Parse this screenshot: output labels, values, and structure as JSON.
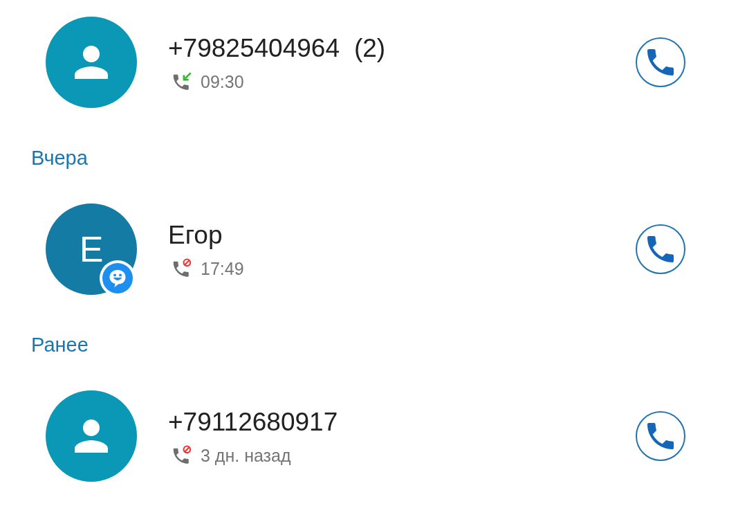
{
  "sections": [
    {
      "entries": [
        {
          "name": "+79825404964",
          "count": "(2)",
          "kind": "incoming",
          "time": "09:30",
          "avatar": {
            "kind": "placeholder",
            "color": "#0b97b6"
          },
          "badge": false
        }
      ]
    },
    {
      "title": "Вчера",
      "entries": [
        {
          "name": "Егор",
          "kind": "blocked",
          "time": "17:49",
          "avatar": {
            "kind": "letter",
            "letter": "E",
            "color": "#137ba4"
          },
          "badge": true
        }
      ]
    },
    {
      "title": "Ранее",
      "entries": [
        {
          "name": "+79112680917",
          "kind": "blocked",
          "time": "3 дн. назад",
          "avatar": {
            "kind": "placeholder",
            "color": "#0b97b6"
          },
          "badge": false
        }
      ]
    }
  ]
}
